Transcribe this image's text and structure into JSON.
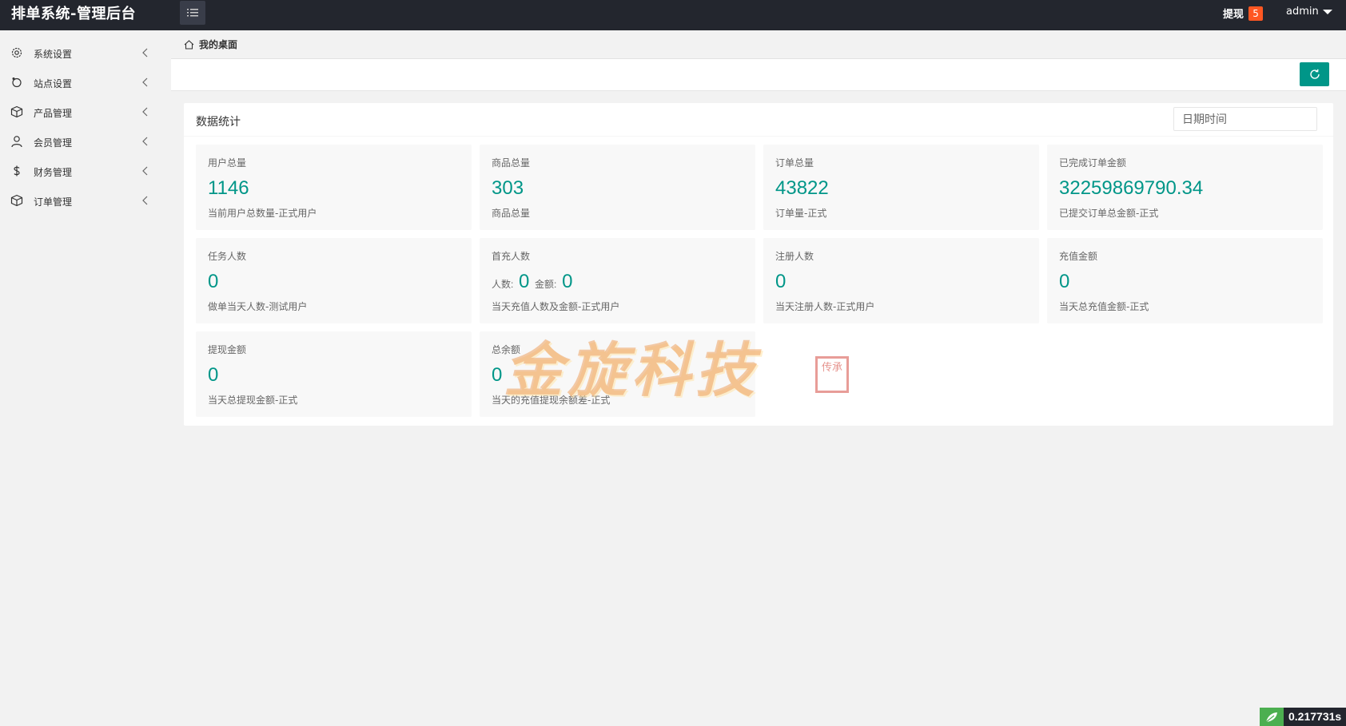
{
  "header": {
    "brand": "排单系统-管理后台",
    "withdraw_label": "提现",
    "withdraw_count": "5",
    "user_name": "admin"
  },
  "sidebar": {
    "items": [
      {
        "label": "系统设置",
        "icon": "gear-icon"
      },
      {
        "label": "站点设置",
        "icon": "site-icon"
      },
      {
        "label": "产品管理",
        "icon": "box-icon"
      },
      {
        "label": "会员管理",
        "icon": "user-icon"
      },
      {
        "label": "财务管理",
        "icon": "dollar-icon"
      },
      {
        "label": "订单管理",
        "icon": "order-icon"
      }
    ]
  },
  "tabs": {
    "home_label": "我的桌面"
  },
  "stats_card": {
    "title": "数据统计",
    "date_placeholder": "日期时间",
    "items": [
      {
        "title": "用户总量",
        "value": "1146",
        "desc": "当前用户总数量-正式用户"
      },
      {
        "title": "商品总量",
        "value": "303",
        "desc": "商品总量"
      },
      {
        "title": "订单总量",
        "value": "43822",
        "desc": "订单量-正式"
      },
      {
        "title": "已完成订单金额",
        "value": "32259869790.34",
        "desc": "已提交订单总金额-正式"
      },
      {
        "title": "任务人数",
        "value": "0",
        "desc": "做单当天人数-测试用户"
      },
      {
        "title": "首充人数",
        "count_label": "人数:",
        "count_value": "0",
        "amount_label": "金额:",
        "amount_value": "0",
        "desc": "当天充值人数及金额-正式用户"
      },
      {
        "title": "注册人数",
        "value": "0",
        "desc": "当天注册人数-正式用户"
      },
      {
        "title": "充值金额",
        "value": "0",
        "desc": "当天总充值金额-正式"
      },
      {
        "title": "提现金额",
        "value": "0",
        "desc": "当天总提现金额-正式"
      },
      {
        "title": "总余额",
        "value": "0",
        "desc": "当天的充值提现余额差-正式"
      }
    ]
  },
  "watermark": {
    "text": "金旋科技",
    "seal": "传承"
  },
  "timer": {
    "value": "0.217731s"
  },
  "colors": {
    "accent": "#009688",
    "topbar": "#23262e",
    "badge": "#ff5722"
  }
}
